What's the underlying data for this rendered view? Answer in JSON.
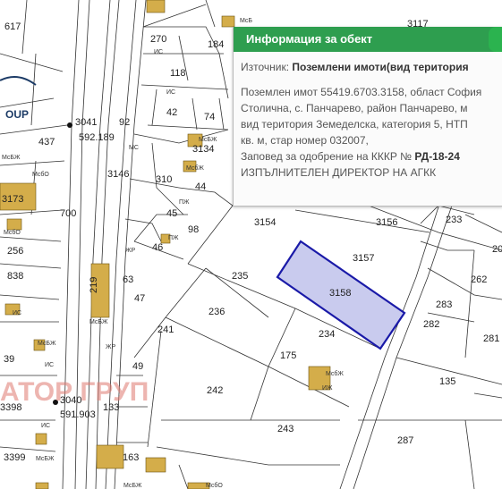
{
  "map": {
    "parcel_labels": [
      "617",
      "270",
      "184",
      "118",
      "3117",
      "42",
      "74",
      "92",
      "437",
      "592.189",
      "3134",
      "3146",
      "310",
      "44",
      "45",
      "98",
      "46",
      "700",
      "3154",
      "3156",
      "233",
      "20",
      "3157",
      "262",
      "235",
      "3158",
      "283",
      "63",
      "47",
      "236",
      "282",
      "281",
      "241",
      "234",
      "175",
      "49",
      "135",
      "242",
      "133",
      "591.903",
      "3398",
      "243",
      "287",
      "3399",
      "163",
      "256",
      "838",
      "39"
    ],
    "small_labels": [
      "МС",
      "МсБ",
      "МсбО",
      "МсБЖ",
      "МсбО",
      "ИС",
      "ИС",
      "МсБЖ",
      "МсбЖ",
      "ПЖ",
      "ПЖ",
      "ЖР",
      "МсБЖ",
      "ЖР",
      "ИС",
      "МсБЖ",
      "ИС",
      "ИС",
      "МсбЖ",
      "ИЖ",
      "МсБЖ",
      "МсБЖ",
      "МсбО"
    ],
    "watermark_top": "OUP",
    "watermark_bottom": "АТОР ГРУП",
    "highlight_color": "#1a1aa8",
    "highlight_fill": "#c9cbee",
    "building_color": "#d4ad4a"
  },
  "popup": {
    "title": "Информация за обект",
    "source_label": "Източник: ",
    "source_value": "Поземлени имоти(вид територия",
    "lines": [
      "Поземлен имот 55419.6703.3158, област София",
      "Столична, с. Панчарево, район Панчарево, м",
      "вид територия Земеделска, категория 5, НТП",
      "кв. м, стар номер 032007,"
    ],
    "order_prefix": "Заповед за одобрение на КККР № ",
    "order_number": "РД-18-24",
    "agency": "ИЗПЪЛНИТЕЛЕН ДИРЕКТОР НА АГКК",
    "header_color": "#2e9e4f"
  }
}
